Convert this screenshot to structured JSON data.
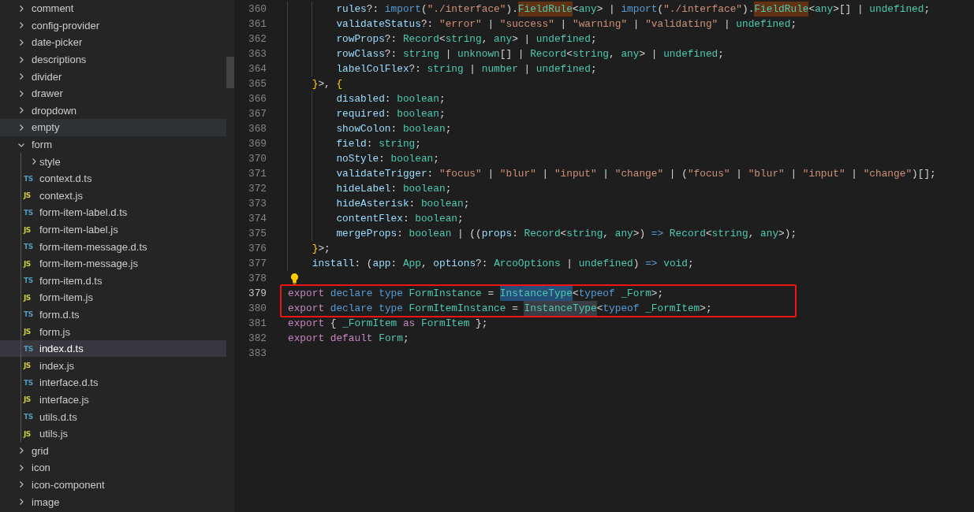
{
  "sidebar": {
    "tree": [
      {
        "label": "comment",
        "kind": "folder",
        "expanded": false,
        "selected": false,
        "hovered": false
      },
      {
        "label": "config-provider",
        "kind": "folder",
        "expanded": false,
        "selected": false,
        "hovered": false
      },
      {
        "label": "date-picker",
        "kind": "folder",
        "expanded": false,
        "selected": false,
        "hovered": false
      },
      {
        "label": "descriptions",
        "kind": "folder",
        "expanded": false,
        "selected": false,
        "hovered": false
      },
      {
        "label": "divider",
        "kind": "folder",
        "expanded": false,
        "selected": false,
        "hovered": false
      },
      {
        "label": "drawer",
        "kind": "folder",
        "expanded": false,
        "selected": false,
        "hovered": false
      },
      {
        "label": "dropdown",
        "kind": "folder",
        "expanded": false,
        "selected": false,
        "hovered": false
      },
      {
        "label": "empty",
        "kind": "folder",
        "expanded": false,
        "selected": false,
        "hovered": true
      },
      {
        "label": "form",
        "kind": "folder",
        "expanded": true,
        "selected": false,
        "hovered": false,
        "children": [
          {
            "label": "style",
            "kind": "folder",
            "expanded": false,
            "selected": false,
            "hovered": false
          },
          {
            "label": "context.d.ts",
            "kind": "ts",
            "badge": "TS",
            "selected": false,
            "hovered": false
          },
          {
            "label": "context.js",
            "kind": "js",
            "badge": "JS",
            "selected": false,
            "hovered": false
          },
          {
            "label": "form-item-label.d.ts",
            "kind": "ts",
            "badge": "TS",
            "selected": false,
            "hovered": false
          },
          {
            "label": "form-item-label.js",
            "kind": "js",
            "badge": "JS",
            "selected": false,
            "hovered": false
          },
          {
            "label": "form-item-message.d.ts",
            "kind": "ts",
            "badge": "TS",
            "selected": false,
            "hovered": false
          },
          {
            "label": "form-item-message.js",
            "kind": "js",
            "badge": "JS",
            "selected": false,
            "hovered": false
          },
          {
            "label": "form-item.d.ts",
            "kind": "ts",
            "badge": "TS",
            "selected": false,
            "hovered": false
          },
          {
            "label": "form-item.js",
            "kind": "js",
            "badge": "JS",
            "selected": false,
            "hovered": false
          },
          {
            "label": "form.d.ts",
            "kind": "ts",
            "badge": "TS",
            "selected": false,
            "hovered": false
          },
          {
            "label": "form.js",
            "kind": "js",
            "badge": "JS",
            "selected": false,
            "hovered": false
          },
          {
            "label": "index.d.ts",
            "kind": "ts",
            "badge": "TS",
            "selected": true,
            "hovered": false
          },
          {
            "label": "index.js",
            "kind": "js",
            "badge": "JS",
            "selected": false,
            "hovered": false
          },
          {
            "label": "interface.d.ts",
            "kind": "ts",
            "badge": "TS",
            "selected": false,
            "hovered": false
          },
          {
            "label": "interface.js",
            "kind": "js",
            "badge": "JS",
            "selected": false,
            "hovered": false
          },
          {
            "label": "utils.d.ts",
            "kind": "ts",
            "badge": "TS",
            "selected": false,
            "hovered": false
          },
          {
            "label": "utils.js",
            "kind": "js",
            "badge": "JS",
            "selected": false,
            "hovered": false
          }
        ]
      },
      {
        "label": "grid",
        "kind": "folder",
        "expanded": false,
        "selected": false,
        "hovered": false
      },
      {
        "label": "icon",
        "kind": "folder",
        "expanded": false,
        "selected": false,
        "hovered": false
      },
      {
        "label": "icon-component",
        "kind": "folder",
        "expanded": false,
        "selected": false,
        "hovered": false
      },
      {
        "label": "image",
        "kind": "folder",
        "expanded": false,
        "selected": false,
        "hovered": false
      }
    ]
  },
  "editor": {
    "lines": [
      {
        "children": [
          {
            "children": [
              {
                "number": "360",
                "current": false,
                "boxed": false,
                "lightbulb": false,
                "tokens": [
                  {
                    "text": "rules",
                    "kind": "prop"
                  },
                  {
                    "text": "?: ",
                    "kind": "punct"
                  },
                  {
                    "text": "import",
                    "kind": "keyword"
                  },
                  {
                    "text": "(",
                    "kind": "punct"
                  },
                  {
                    "text": "\"./interface\"",
                    "kind": "string"
                  },
                  {
                    "text": ").",
                    "kind": "punct"
                  },
                  {
                    "text": "FieldRule",
                    "kind": "type",
                    "color": "#613214"
                  },
                  {
                    "text": "<",
                    "kind": "punct"
                  },
                  {
                    "text": "any",
                    "kind": "type"
                  },
                  {
                    "text": "> | ",
                    "kind": "punct"
                  },
                  {
                    "text": "import",
                    "kind": "keyword"
                  },
                  {
                    "text": "(",
                    "kind": "punct"
                  },
                  {
                    "text": "\"./interface\"",
                    "kind": "string"
                  },
                  {
                    "text": ").",
                    "kind": "punct"
                  },
                  {
                    "text": "FieldRule",
                    "kind": "type",
                    "color": "#613214"
                  },
                  {
                    "text": "<",
                    "kind": "punct"
                  },
                  {
                    "text": "any",
                    "kind": "type"
                  },
                  {
                    "text": ">[] | ",
                    "kind": "punct"
                  },
                  {
                    "text": "undefined",
                    "kind": "type"
                  },
                  {
                    "text": ";",
                    "kind": "punct"
                  }
                ]
              },
              {
                "number": "361",
                "current": false,
                "boxed": false,
                "lightbulb": false,
                "tokens": [
                  {
                    "text": "validateStatus",
                    "kind": "prop"
                  },
                  {
                    "text": "?: ",
                    "kind": "punct"
                  },
                  {
                    "text": "\"error\"",
                    "kind": "string"
                  },
                  {
                    "text": " | ",
                    "kind": "punct"
                  },
                  {
                    "text": "\"success\"",
                    "kind": "string"
                  },
                  {
                    "text": " | ",
                    "kind": "punct"
                  },
                  {
                    "text": "\"warning\"",
                    "kind": "string"
                  },
                  {
                    "text": " | ",
                    "kind": "punct"
                  },
                  {
                    "text": "\"validating\"",
                    "kind": "string"
                  },
                  {
                    "text": " | ",
                    "kind": "punct"
                  },
                  {
                    "text": "undefined",
                    "kind": "type"
                  },
                  {
                    "text": ";",
                    "kind": "punct"
                  }
                ]
              },
              {
                "number": "362",
                "current": false,
                "boxed": false,
                "lightbulb": false,
                "tokens": [
                  {
                    "text": "rowProps",
                    "kind": "prop"
                  },
                  {
                    "text": "?: ",
                    "kind": "punct"
                  },
                  {
                    "text": "Record",
                    "kind": "type"
                  },
                  {
                    "text": "<",
                    "kind": "punct"
                  },
                  {
                    "text": "string",
                    "kind": "type"
                  },
                  {
                    "text": ", ",
                    "kind": "punct"
                  },
                  {
                    "text": "any",
                    "kind": "type"
                  },
                  {
                    "text": "> | ",
                    "kind": "punct"
                  },
                  {
                    "text": "undefined",
                    "kind": "type"
                  },
                  {
                    "text": ";",
                    "kind": "punct"
                  }
                ]
              },
              {
                "number": "363",
                "current": false,
                "boxed": false,
                "lightbulb": false,
                "tokens": [
                  {
                    "text": "rowClass",
                    "kind": "prop"
                  },
                  {
                    "text": "?: ",
                    "kind": "punct"
                  },
                  {
                    "text": "string",
                    "kind": "type"
                  },
                  {
                    "text": " | ",
                    "kind": "punct"
                  },
                  {
                    "text": "unknown",
                    "kind": "type"
                  },
                  {
                    "text": "[] | ",
                    "kind": "punct"
                  },
                  {
                    "text": "Record",
                    "kind": "type"
                  },
                  {
                    "text": "<",
                    "kind": "punct"
                  },
                  {
                    "text": "string",
                    "kind": "type"
                  },
                  {
                    "text": ", ",
                    "kind": "punct"
                  },
                  {
                    "text": "any",
                    "kind": "type"
                  },
                  {
                    "text": "> | ",
                    "kind": "punct"
                  },
                  {
                    "text": "undefined",
                    "kind": "type"
                  },
                  {
                    "text": ";",
                    "kind": "punct"
                  }
                ]
              },
              {
                "number": "364",
                "current": false,
                "boxed": false,
                "lightbulb": false,
                "tokens": [
                  {
                    "text": "labelColFlex",
                    "kind": "prop"
                  },
                  {
                    "text": "?: ",
                    "kind": "punct"
                  },
                  {
                    "text": "string",
                    "kind": "type"
                  },
                  {
                    "text": " | ",
                    "kind": "punct"
                  },
                  {
                    "text": "number",
                    "kind": "type"
                  },
                  {
                    "text": " | ",
                    "kind": "punct"
                  },
                  {
                    "text": "undefined",
                    "kind": "type"
                  },
                  {
                    "text": ";",
                    "kind": "punct"
                  }
                ]
              }
            ]
          },
          {
            "number": "365",
            "current": false,
            "boxed": false,
            "lightbulb": false,
            "tokens": [
              {
                "text": "}",
                "kind": "bracket"
              },
              {
                "text": ">, ",
                "kind": "punct"
              },
              {
                "text": "{",
                "kind": "bracket"
              }
            ]
          },
          {
            "children": [
              {
                "number": "366",
                "current": false,
                "boxed": false,
                "lightbulb": false,
                "tokens": [
                  {
                    "text": "disabled",
                    "kind": "prop"
                  },
                  {
                    "text": ": ",
                    "kind": "punct"
                  },
                  {
                    "text": "boolean",
                    "kind": "type"
                  },
                  {
                    "text": ";",
                    "kind": "punct"
                  }
                ]
              },
              {
                "number": "367",
                "current": false,
                "boxed": false,
                "lightbulb": false,
                "tokens": [
                  {
                    "text": "required",
                    "kind": "prop"
                  },
                  {
                    "text": ": ",
                    "kind": "punct"
                  },
                  {
                    "text": "boolean",
                    "kind": "type"
                  },
                  {
                    "text": ";",
                    "kind": "punct"
                  }
                ]
              },
              {
                "number": "368",
                "current": false,
                "boxed": false,
                "lightbulb": false,
                "tokens": [
                  {
                    "text": "showColon",
                    "kind": "prop"
                  },
                  {
                    "text": ": ",
                    "kind": "punct"
                  },
                  {
                    "text": "boolean",
                    "kind": "type"
                  },
                  {
                    "text": ";",
                    "kind": "punct"
                  }
                ]
              },
              {
                "number": "369",
                "current": false,
                "boxed": false,
                "lightbulb": false,
                "tokens": [
                  {
                    "text": "field",
                    "kind": "prop"
                  },
                  {
                    "text": ": ",
                    "kind": "punct"
                  },
                  {
                    "text": "string",
                    "kind": "type"
                  },
                  {
                    "text": ";",
                    "kind": "punct"
                  }
                ]
              },
              {
                "number": "370",
                "current": false,
                "boxed": false,
                "lightbulb": false,
                "tokens": [
                  {
                    "text": "noStyle",
                    "kind": "prop"
                  },
                  {
                    "text": ": ",
                    "kind": "punct"
                  },
                  {
                    "text": "boolean",
                    "kind": "type"
                  },
                  {
                    "text": ";",
                    "kind": "punct"
                  }
                ]
              },
              {
                "number": "371",
                "current": false,
                "boxed": false,
                "lightbulb": false,
                "tokens": [
                  {
                    "text": "validateTrigger",
                    "kind": "prop"
                  },
                  {
                    "text": ": ",
                    "kind": "punct"
                  },
                  {
                    "text": "\"focus\"",
                    "kind": "string"
                  },
                  {
                    "text": " | ",
                    "kind": "punct"
                  },
                  {
                    "text": "\"blur\"",
                    "kind": "string"
                  },
                  {
                    "text": " | ",
                    "kind": "punct"
                  },
                  {
                    "text": "\"input\"",
                    "kind": "string"
                  },
                  {
                    "text": " | ",
                    "kind": "punct"
                  },
                  {
                    "text": "\"change\"",
                    "kind": "string"
                  },
                  {
                    "text": " | (",
                    "kind": "punct"
                  },
                  {
                    "text": "\"focus\"",
                    "kind": "string"
                  },
                  {
                    "text": " | ",
                    "kind": "punct"
                  },
                  {
                    "text": "\"blur\"",
                    "kind": "string"
                  },
                  {
                    "text": " | ",
                    "kind": "punct"
                  },
                  {
                    "text": "\"input\"",
                    "kind": "string"
                  },
                  {
                    "text": " | ",
                    "kind": "punct"
                  },
                  {
                    "text": "\"change\"",
                    "kind": "string"
                  },
                  {
                    "text": ")[];",
                    "kind": "punct"
                  }
                ]
              },
              {
                "number": "372",
                "current": false,
                "boxed": false,
                "lightbulb": false,
                "tokens": [
                  {
                    "text": "hideLabel",
                    "kind": "prop"
                  },
                  {
                    "text": ": ",
                    "kind": "punct"
                  },
                  {
                    "text": "boolean",
                    "kind": "type"
                  },
                  {
                    "text": ";",
                    "kind": "punct"
                  }
                ]
              },
              {
                "number": "373",
                "current": false,
                "boxed": false,
                "lightbulb": false,
                "tokens": [
                  {
                    "text": "hideAsterisk",
                    "kind": "prop"
                  },
                  {
                    "text": ": ",
                    "kind": "punct"
                  },
                  {
                    "text": "boolean",
                    "kind": "type"
                  },
                  {
                    "text": ";",
                    "kind": "punct"
                  }
                ]
              },
              {
                "number": "374",
                "current": false,
                "boxed": false,
                "lightbulb": false,
                "tokens": [
                  {
                    "text": "contentFlex",
                    "kind": "prop"
                  },
                  {
                    "text": ": ",
                    "kind": "punct"
                  },
                  {
                    "text": "boolean",
                    "kind": "type"
                  },
                  {
                    "text": ";",
                    "kind": "punct"
                  }
                ]
              },
              {
                "number": "375",
                "current": false,
                "boxed": false,
                "lightbulb": false,
                "tokens": [
                  {
                    "text": "mergeProps",
                    "kind": "prop"
                  },
                  {
                    "text": ": ",
                    "kind": "punct"
                  },
                  {
                    "text": "boolean",
                    "kind": "type"
                  },
                  {
                    "text": " | ((",
                    "kind": "punct"
                  },
                  {
                    "text": "props",
                    "kind": "prop"
                  },
                  {
                    "text": ": ",
                    "kind": "punct"
                  },
                  {
                    "text": "Record",
                    "kind": "type"
                  },
                  {
                    "text": "<",
                    "kind": "punct"
                  },
                  {
                    "text": "string",
                    "kind": "type"
                  },
                  {
                    "text": ", ",
                    "kind": "punct"
                  },
                  {
                    "text": "any",
                    "kind": "type"
                  },
                  {
                    "text": ">) ",
                    "kind": "punct"
                  },
                  {
                    "text": "=> ",
                    "kind": "keyword"
                  },
                  {
                    "text": "Record",
                    "kind": "type"
                  },
                  {
                    "text": "<",
                    "kind": "punct"
                  },
                  {
                    "text": "string",
                    "kind": "type"
                  },
                  {
                    "text": ", ",
                    "kind": "punct"
                  },
                  {
                    "text": "any",
                    "kind": "type"
                  },
                  {
                    "text": ">);",
                    "kind": "punct"
                  }
                ]
              }
            ]
          },
          {
            "number": "376",
            "current": false,
            "boxed": false,
            "lightbulb": false,
            "tokens": [
              {
                "text": "}",
                "kind": "bracket"
              },
              {
                "text": ">;",
                "kind": "punct"
              }
            ]
          },
          {
            "number": "377",
            "current": false,
            "boxed": false,
            "lightbulb": false,
            "tokens": [
              {
                "text": "install",
                "kind": "prop"
              },
              {
                "text": ": (",
                "kind": "punct"
              },
              {
                "text": "app",
                "kind": "prop"
              },
              {
                "text": ": ",
                "kind": "punct"
              },
              {
                "text": "App",
                "kind": "type"
              },
              {
                "text": ", ",
                "kind": "punct"
              },
              {
                "text": "options",
                "kind": "prop"
              },
              {
                "text": "?: ",
                "kind": "punct"
              },
              {
                "text": "ArcoOptions",
                "kind": "type"
              },
              {
                "text": " | ",
                "kind": "punct"
              },
              {
                "text": "undefined",
                "kind": "type"
              },
              {
                "text": ") ",
                "kind": "punct"
              },
              {
                "text": "=> ",
                "kind": "keyword"
              },
              {
                "text": "void",
                "kind": "type"
              },
              {
                "text": ";",
                "kind": "punct"
              }
            ]
          }
        ]
      },
      {
        "number": "378",
        "current": false,
        "boxed": false,
        "lightbulb": true
      },
      {
        "number": "379",
        "current": true,
        "boxed": true,
        "lightbulb": false,
        "tokens": [
          {
            "text": "export ",
            "kind": "control"
          },
          {
            "text": "declare type ",
            "kind": "keyword"
          },
          {
            "text": "FormInstance",
            "kind": "type"
          },
          {
            "text": " = ",
            "kind": "punct"
          },
          {
            "text": "InstanceType",
            "kind": "type",
            "color": "#264f78"
          },
          {
            "text": "<",
            "kind": "punct"
          },
          {
            "text": "typeof ",
            "kind": "keyword"
          },
          {
            "text": "_Form",
            "kind": "type"
          },
          {
            "text": ">;",
            "kind": "punct"
          }
        ]
      },
      {
        "number": "380",
        "current": false,
        "boxed": true,
        "lightbulb": false,
        "tokens": [
          {
            "text": "export ",
            "kind": "control"
          },
          {
            "text": "declare type ",
            "kind": "keyword"
          },
          {
            "text": "FormItemInstance",
            "kind": "type"
          },
          {
            "text": " = ",
            "kind": "punct"
          },
          {
            "text": "InstanceType",
            "kind": "type",
            "color": "#3a3d41"
          },
          {
            "text": "<",
            "kind": "punct"
          },
          {
            "text": "typeof ",
            "kind": "keyword"
          },
          {
            "text": "_FormItem",
            "kind": "type"
          },
          {
            "text": ">;",
            "kind": "punct"
          }
        ]
      },
      {
        "number": "381",
        "current": false,
        "boxed": false,
        "lightbulb": false,
        "tokens": [
          {
            "text": "export",
            "kind": "control"
          },
          {
            "text": " { ",
            "kind": "punct"
          },
          {
            "text": "_FormItem ",
            "kind": "type"
          },
          {
            "text": "as ",
            "kind": "control"
          },
          {
            "text": "FormItem",
            "kind": "type"
          },
          {
            "text": " };",
            "kind": "punct"
          }
        ]
      },
      {
        "number": "382",
        "current": false,
        "boxed": false,
        "lightbulb": false,
        "tokens": [
          {
            "text": "export default ",
            "kind": "control"
          },
          {
            "text": "Form",
            "kind": "type"
          },
          {
            "text": ";",
            "kind": "punct"
          }
        ]
      },
      {
        "number": "383",
        "current": false,
        "boxed": false,
        "lightbulb": false
      }
    ]
  }
}
